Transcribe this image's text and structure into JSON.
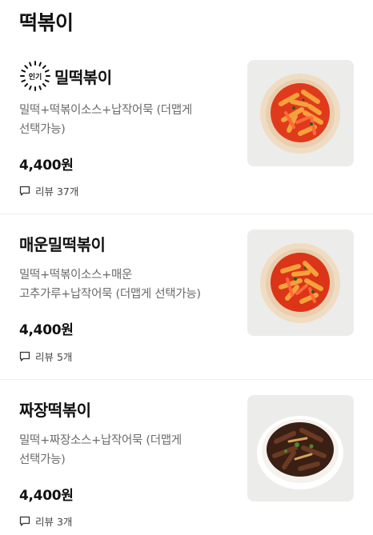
{
  "section": {
    "title": "떡볶이"
  },
  "items": [
    {
      "badge": "인기",
      "name": "밀떡볶이",
      "desc_line1": "밀떡+떡볶이소스+납작어묵 (더맵게",
      "desc_line2": "선택가능)",
      "price": "4,400원",
      "review": "리뷰 37개",
      "sauce": "red"
    },
    {
      "name": "매운밀떡볶이",
      "desc_line1": "밀떡+떡볶이소스+매운",
      "desc_line2": "고추가루+납작어묵 (더맵게 선택가능)",
      "price": "4,400원",
      "review": "리뷰 5개",
      "sauce": "red"
    },
    {
      "name": "짜장떡볶이",
      "desc_line1": "밀떡+짜장소스+납작어묵 (더맵게",
      "desc_line2": "선택가능)",
      "price": "4,400원",
      "review": "리뷰 3개",
      "sauce": "black"
    }
  ],
  "colors": {
    "red_sauce": "#e03a1c",
    "black_sauce": "#3a1f14",
    "bowl_beige": "#f0dcc2",
    "bg_gray": "#ececea"
  },
  "icons": {
    "badge": "sunburst-badge",
    "review": "chat-bubble-icon"
  }
}
